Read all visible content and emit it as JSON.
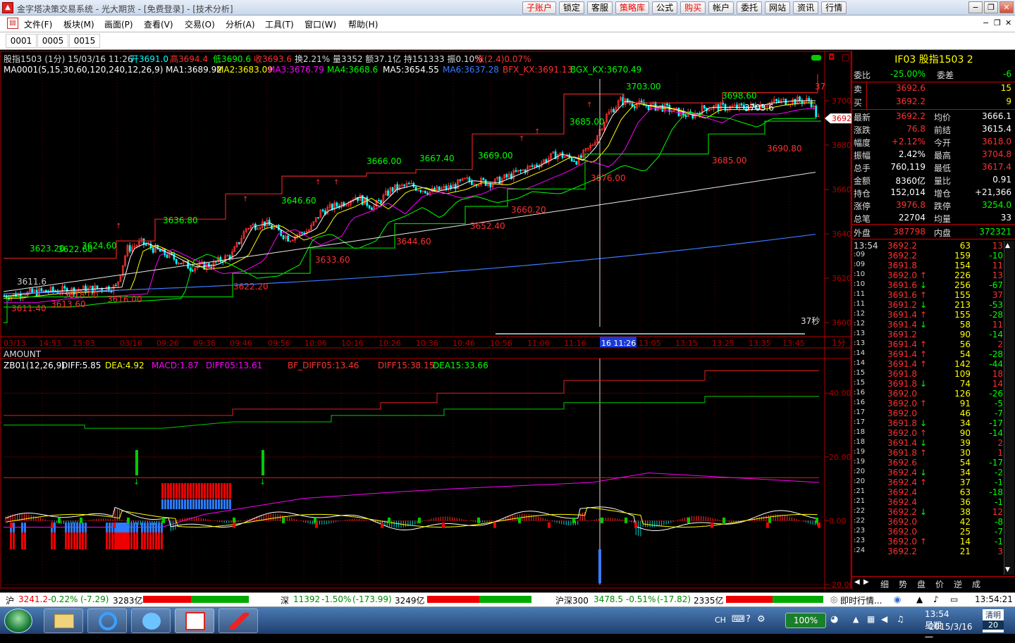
{
  "window": {
    "title": "金字塔决策交易系统 - 光大期货 - [免费登录] - [技术分析]"
  },
  "top_buttons": [
    {
      "label": "子账户",
      "red": true
    },
    {
      "label": "锁定",
      "red": false
    },
    {
      "label": "客服",
      "red": false
    },
    {
      "label": "策略库",
      "red": true
    },
    {
      "label": "公式",
      "red": false
    },
    {
      "label": "购买",
      "red": true
    },
    {
      "label": "帐户",
      "red": false
    },
    {
      "label": "委托",
      "red": false
    },
    {
      "label": "网站",
      "red": false
    },
    {
      "label": "资讯",
      "red": false
    },
    {
      "label": "行情",
      "red": false
    }
  ],
  "window_controls": {
    "minimize": "−",
    "restore": "❐",
    "close": "✕",
    "mdi_minimize": "−",
    "mdi_restore": "❐",
    "mdi_close": "✕"
  },
  "menu": [
    "文件(F)",
    "板块(M)",
    "画面(P)",
    "查看(V)",
    "交易(O)",
    "分析(A)",
    "工具(T)",
    "窗口(W)",
    "帮助(H)"
  ],
  "tabs": [
    "0001",
    "0005",
    "0015"
  ],
  "chart": {
    "info_line": {
      "prefix": "股指1503 (1分) 15/03/16 11:26",
      "open": "开3691.0",
      "high": "高3694.4",
      "low": "低3690.6",
      "close": "收3693.6",
      "rest": "换2.21% 量3352 额37.1亿 持151333 振0.10%",
      "chg": "涨(2.4)0.07%"
    },
    "ma_line": [
      {
        "text": "MA0001(5,15,30,60,120,240,12,26,9)",
        "color": "#ffffff"
      },
      {
        "text": "MA1:3689.92",
        "color": "#ffffff"
      },
      {
        "text": "MA2:3683.09",
        "color": "#ffff00"
      },
      {
        "text": "MA3:3676.79",
        "color": "#ff00ff"
      },
      {
        "text": "MA4:3668.6",
        "color": "#00ff00"
      },
      {
        "text": "MA5:3654.55",
        "color": "#ffffff"
      },
      {
        "text": "MA6:3637.28",
        "color": "#3a7bff"
      },
      {
        "text": "BFX_KX:3691.13",
        "color": "#ff3030"
      },
      {
        "text": "BGX_KX:3670.49",
        "color": "#00ff00"
      }
    ],
    "price_axis": [
      "3700",
      "3680",
      "3660",
      "3640",
      "3620",
      "3600"
    ],
    "price_range": [
      3594,
      3713
    ],
    "current_price_tag": "3692",
    "time_labels": [
      "03/13",
      "14:53",
      "15:03",
      "03/16",
      "09:26",
      "09:36",
      "09:46",
      "09:56",
      "10:06",
      "10:16",
      "10:26",
      "10:36",
      "10:46",
      "10:56",
      "11:06",
      "11:16",
      "16 11:26",
      "13:05",
      "13:15",
      "13:25",
      "13:35",
      "13:45"
    ],
    "period_label": "1分",
    "countdown": "37秒",
    "top_right_label": "37",
    "green_levels": [
      "3623.20",
      "3622.60",
      "3624.60",
      "3636.80",
      "3646.60",
      "3666.00",
      "3667.40",
      "3669.00",
      "3685.00",
      "3703.00",
      "3698.60"
    ],
    "red_levels": [
      "3611.6",
      "3611.40",
      "3613.60",
      "3618.00",
      "3616.00",
      "3622.20",
      "3633.60",
      "3644.60",
      "3652.40",
      "3660.20",
      "3676.00",
      "3685.00",
      "3690.80"
    ],
    "white_levels": [
      "3703.6"
    ],
    "amount_label": "AMOUNT",
    "macd_line": [
      {
        "text": "ZB01(12,26,9)",
        "color": "#ffffff"
      },
      {
        "text": "DIFF:5.85",
        "color": "#ffffff"
      },
      {
        "text": "DEA:4.92",
        "color": "#ffff00"
      },
      {
        "text": "MACD:1.87",
        "color": "#ff00ff"
      },
      {
        "text": "DIFF05:13.61",
        "color": "#ff00ff"
      },
      {
        "text": "BF_DIFF05:13.46",
        "color": "#ff3030"
      },
      {
        "text": "DIFF15:38.15",
        "color": "#ff3030"
      },
      {
        "text": "DEA15:33.66",
        "color": "#00ff00"
      }
    ],
    "macd_axis": [
      "40.00",
      "20.00",
      "0.00",
      "-20.00"
    ]
  },
  "right_panel": {
    "header": "IF03  股指1503  2",
    "weibi": {
      "label": "委比",
      "value": "-25.00%",
      "label2": "委差",
      "value2": "-6"
    },
    "sell": {
      "label": "卖",
      "price": "3692.6",
      "vol": "15"
    },
    "buy": {
      "label": "买",
      "price": "3692.2",
      "vol": "9"
    },
    "quote_rows": [
      {
        "l1": "最新",
        "v1": "3692.2",
        "c1": "#ff3030",
        "l2": "均价",
        "v2": "3666.1",
        "c2": "#ffffff"
      },
      {
        "l1": "涨跌",
        "v1": "76.8",
        "c1": "#ff3030",
        "l2": "前结",
        "v2": "3615.4",
        "c2": "#ffffff"
      },
      {
        "l1": "幅度",
        "v1": "+2.12%",
        "c1": "#ff3030",
        "l2": "今开",
        "v2": "3618.0",
        "c2": "#ff3030"
      },
      {
        "l1": "振幅",
        "v1": "2.42%",
        "c1": "#ffffff",
        "l2": "最高",
        "v2": "3704.8",
        "c2": "#ff3030"
      },
      {
        "l1": "总手",
        "v1": "760,119",
        "c1": "#ffffff",
        "l2": "最低",
        "v2": "3617.4",
        "c2": "#ff3030"
      },
      {
        "l1": "金额",
        "v1": "8360亿",
        "c1": "#ffffff",
        "l2": "量比",
        "v2": "0.91",
        "c2": "#ffffff"
      },
      {
        "l1": "持仓",
        "v1": "152,014",
        "c1": "#ffffff",
        "l2": "增仓",
        "v2": "+21,366",
        "c2": "#ffffff"
      },
      {
        "l1": "涨停",
        "v1": "3976.8",
        "c1": "#ff3030",
        "l2": "跌停",
        "v2": "3254.0",
        "c2": "#00ff00"
      },
      {
        "l1": "总笔",
        "v1": "22704",
        "c1": "#ffffff",
        "l2": "均量",
        "v2": "33",
        "c2": "#ffffff"
      }
    ],
    "waipan": {
      "label": "外盘",
      "value": "387798",
      "label2": "内盘",
      "value2": "372321"
    },
    "ticks": [
      {
        "t": "13:54",
        "p": "3692.2",
        "a": "",
        "v": "63",
        "d": "13"
      },
      {
        "t": ":09",
        "p": "3692.2",
        "a": "",
        "v": "159",
        "d": "-10"
      },
      {
        "t": ":09",
        "p": "3691.8",
        "a": "",
        "v": "154",
        "d": "11"
      },
      {
        "t": ":10",
        "p": "3692.0",
        "a": "up",
        "v": "226",
        "d": "13"
      },
      {
        "t": ":10",
        "p": "3691.6",
        "a": "dn",
        "v": "256",
        "d": "-67"
      },
      {
        "t": ":11",
        "p": "3691.6",
        "a": "up",
        "v": "155",
        "d": "37"
      },
      {
        "t": ":11",
        "p": "3691.2",
        "a": "dn",
        "v": "213",
        "d": "-53"
      },
      {
        "t": ":12",
        "p": "3691.4",
        "a": "up",
        "v": "155",
        "d": "-28"
      },
      {
        "t": ":12",
        "p": "3691.4",
        "a": "dn",
        "v": "58",
        "d": "11"
      },
      {
        "t": ":13",
        "p": "3691.2",
        "a": "",
        "v": "90",
        "d": "-14"
      },
      {
        "t": ":13",
        "p": "3691.4",
        "a": "up",
        "v": "56",
        "d": "2"
      },
      {
        "t": ":14",
        "p": "3691.4",
        "a": "up",
        "v": "54",
        "d": "-28"
      },
      {
        "t": ":14",
        "p": "3691.4",
        "a": "up",
        "v": "142",
        "d": "-44"
      },
      {
        "t": ":15",
        "p": "3691.8",
        "a": "",
        "v": "109",
        "d": "18"
      },
      {
        "t": ":15",
        "p": "3691.8",
        "a": "dn",
        "v": "74",
        "d": "14"
      },
      {
        "t": ":16",
        "p": "3692.0",
        "a": "",
        "v": "126",
        "d": "-26"
      },
      {
        "t": ":16",
        "p": "3692.0",
        "a": "up",
        "v": "91",
        "d": "-5"
      },
      {
        "t": ":17",
        "p": "3692.0",
        "a": "",
        "v": "46",
        "d": "-7"
      },
      {
        "t": ":17",
        "p": "3691.8",
        "a": "dn",
        "v": "34",
        "d": "-17"
      },
      {
        "t": ":18",
        "p": "3692.0",
        "a": "up",
        "v": "90",
        "d": "-14"
      },
      {
        "t": ":18",
        "p": "3691.4",
        "a": "dn",
        "v": "39",
        "d": "2"
      },
      {
        "t": ":19",
        "p": "3691.8",
        "a": "up",
        "v": "30",
        "d": "1"
      },
      {
        "t": ":19",
        "p": "3692.6",
        "a": "",
        "v": "54",
        "d": "-17"
      },
      {
        "t": ":20",
        "p": "3692.4",
        "a": "dn",
        "v": "34",
        "d": "-2"
      },
      {
        "t": ":20",
        "p": "3692.4",
        "a": "up",
        "v": "37",
        "d": "-1"
      },
      {
        "t": ":21",
        "p": "3692.4",
        "a": "",
        "v": "63",
        "d": "-18"
      },
      {
        "t": ":21",
        "p": "3692.4",
        "a": "",
        "v": "36",
        "d": "-1"
      },
      {
        "t": ":22",
        "p": "3692.2",
        "a": "dn",
        "v": "38",
        "d": "12"
      },
      {
        "t": ":22",
        "p": "3692.0",
        "a": "",
        "v": "42",
        "d": "-8"
      },
      {
        "t": ":23",
        "p": "3692.0",
        "a": "",
        "v": "25",
        "d": "-7"
      },
      {
        "t": ":23",
        "p": "3692.0",
        "a": "up",
        "v": "14",
        "d": "-1"
      },
      {
        "t": ":24",
        "p": "3692.2",
        "a": "",
        "v": "21",
        "d": "3"
      }
    ],
    "bottom_tabs": [
      "细",
      "势",
      "盘",
      "价",
      "逆",
      "成"
    ]
  },
  "statusbar": {
    "sh": {
      "label": "沪",
      "value": "3241.2",
      "chg": "-0.22%",
      "diff": "(-7.29)",
      "amount": "3283亿"
    },
    "sz": {
      "label": "深",
      "value": "11392",
      "chg": "-1.50%",
      "diff": "(-173.99)",
      "amount": "3249亿"
    },
    "hs300": {
      "label": "沪深300",
      "value": "3478.5",
      "chg": "-0.51%",
      "diff": "(-17.82)",
      "amount": "2335亿"
    },
    "instant": "即时行情...",
    "time": "13:54:21"
  },
  "taskbar": {
    "clock_time": "13:54 星期一",
    "clock_date": "2015/3/16",
    "zoom": "100%",
    "lang": "CH",
    "qingming": "清明",
    "day": "20"
  }
}
